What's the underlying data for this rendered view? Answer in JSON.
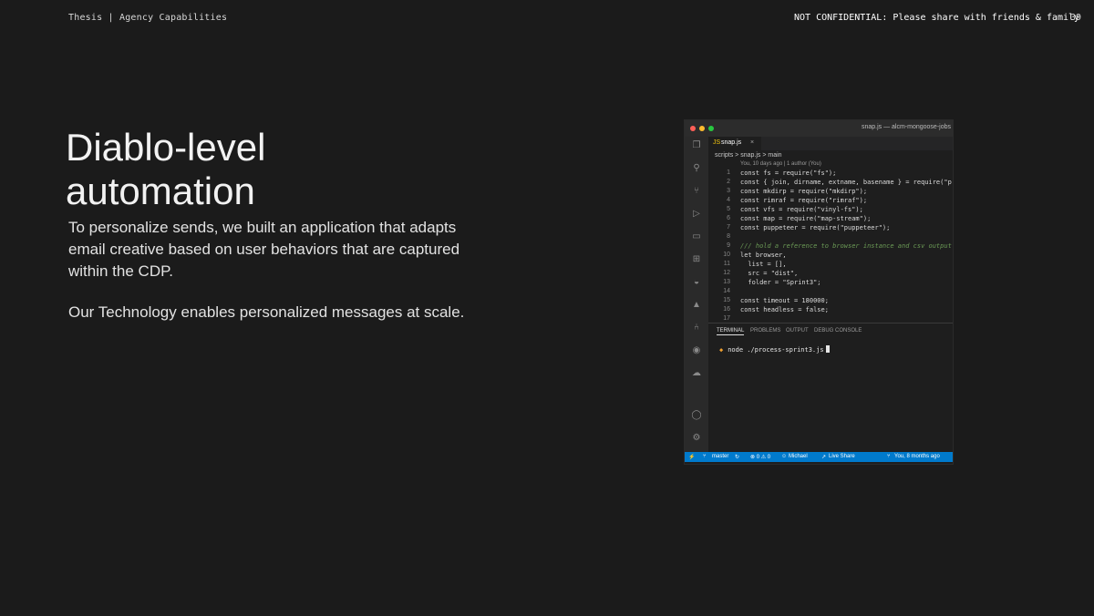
{
  "header": {
    "left": "Thesis | Agency Capabilities",
    "right": "NOT CONFIDENTIAL: Please share with friends & family",
    "page_number": "39"
  },
  "slide": {
    "title_line1": "Diablo-level",
    "title_line2": "automation",
    "paragraph1": "To personalize sends, we built an application that adapts email creative based on user behaviors that are captured within the CDP.",
    "paragraph2": "Our Technology enables personalized messages at scale."
  },
  "editor": {
    "window_title": "snap.js — alcm-mongoose-jobs",
    "tab_label": "snap.js",
    "tab_close": "×",
    "breadcrumb": "scripts > snap.js > main",
    "blame": "You, 10 days ago | 1 author (You)",
    "line_numbers": [
      "1",
      "2",
      "3",
      "4",
      "5",
      "6",
      "7",
      "8",
      "9",
      "10",
      "11",
      "12",
      "13",
      "14",
      "15",
      "16",
      "17"
    ],
    "code_lines": [
      "const fs = require(\"fs\");",
      "const { join, dirname, extname, basename } = require(\"p",
      "const mkdirp = require(\"mkdirp\");",
      "const rimraf = require(\"rimraf\");",
      "const vfs = require(\"vinyl-fs\");",
      "const map = require(\"map-stream\");",
      "const puppeteer = require(\"puppeteer\");",
      "",
      "/// hold a reference to browser instance and csv output",
      "let browser,",
      "  list = [],",
      "  src = \"dist\",",
      "  folder = \"Sprint3\";",
      "",
      "const timeout = 180000;",
      "const headless = false;",
      ""
    ],
    "panel_tabs": {
      "terminal": "TERMINAL",
      "problems": "PROBLEMS",
      "output": "OUTPUT",
      "debug": "DEBUG CONSOLE"
    },
    "terminal_command": "node ./process-sprint3.js",
    "status": {
      "branch": "master",
      "problems": "⊗ 0 ⚠ 0",
      "user": "Michael",
      "live_share": "Live Share",
      "blame": "You, 8 months ago"
    }
  },
  "colors": {
    "background": "#1b1b1b",
    "status_bar": "#007acc",
    "mac_close": "#ff5f57",
    "mac_min": "#febc2e",
    "mac_max": "#28c840"
  },
  "icons": [
    "files-icon",
    "search-icon",
    "source-control-icon",
    "run-debug-icon",
    "remote-explorer-icon",
    "extensions-icon",
    "docker-icon",
    "azure-icon",
    "git-graph-icon",
    "live-share-icon",
    "cloud-icon",
    "account-icon",
    "settings-gear-icon"
  ]
}
